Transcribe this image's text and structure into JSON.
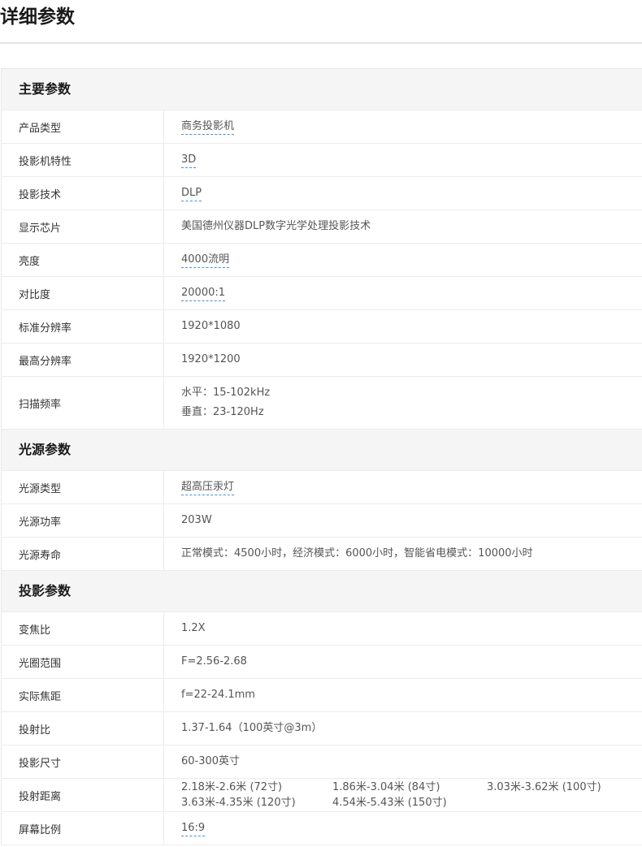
{
  "page_title": "详细参数",
  "sections": [
    {
      "title": "主要参数",
      "rows": [
        {
          "label": "产品类型",
          "value": "商务投影机",
          "linked": true
        },
        {
          "label": "投影机特性",
          "value": "3D",
          "linked": true
        },
        {
          "label": "投影技术",
          "value": "DLP",
          "linked": true
        },
        {
          "label": "显示芯片",
          "value": "美国德州仪器DLP数字光学处理投影技术",
          "linked": false
        },
        {
          "label": "亮度",
          "value": "4000流明",
          "linked": true
        },
        {
          "label": "对比度",
          "value": "20000:1",
          "linked": true
        },
        {
          "label": "标准分辨率",
          "value": "1920*1080",
          "linked": false
        },
        {
          "label": "最高分辨率",
          "value": "1920*1200",
          "linked": false
        },
        {
          "label": "扫描频率",
          "lines": [
            "水平：15-102kHz",
            "垂直：23-120Hz"
          ],
          "linked": false
        }
      ]
    },
    {
      "title": "光源参数",
      "rows": [
        {
          "label": "光源类型",
          "value": "超高压汞灯",
          "linked": true
        },
        {
          "label": "光源功率",
          "value": "203W",
          "linked": false
        },
        {
          "label": "光源寿命",
          "value": "正常模式：4500小时，经济模式：6000小时，智能省电模式：10000小时",
          "linked": false
        }
      ]
    },
    {
      "title": "投影参数",
      "rows": [
        {
          "label": "变焦比",
          "value": "1.2X",
          "linked": false
        },
        {
          "label": "光圈范围",
          "value": "F=2.56-2.68",
          "linked": false
        },
        {
          "label": "实际焦距",
          "value": "f=22-24.1mm",
          "linked": false
        },
        {
          "label": "投射比",
          "value": "1.37-1.64（100英寸@3m）",
          "linked": false
        },
        {
          "label": "投影尺寸",
          "value": "60-300英寸",
          "linked": false
        },
        {
          "label": "投射距离",
          "grid": [
            "2.18米-2.6米 (72寸)",
            "1.86米-3.04米 (84寸)",
            "3.03米-3.62米 (100寸)",
            "3.63米-4.35米 (120寸)",
            "4.54米-5.43米 (150寸)"
          ],
          "linked": false
        },
        {
          "label": "屏幕比例",
          "value": "16:9",
          "linked": true
        }
      ]
    }
  ]
}
